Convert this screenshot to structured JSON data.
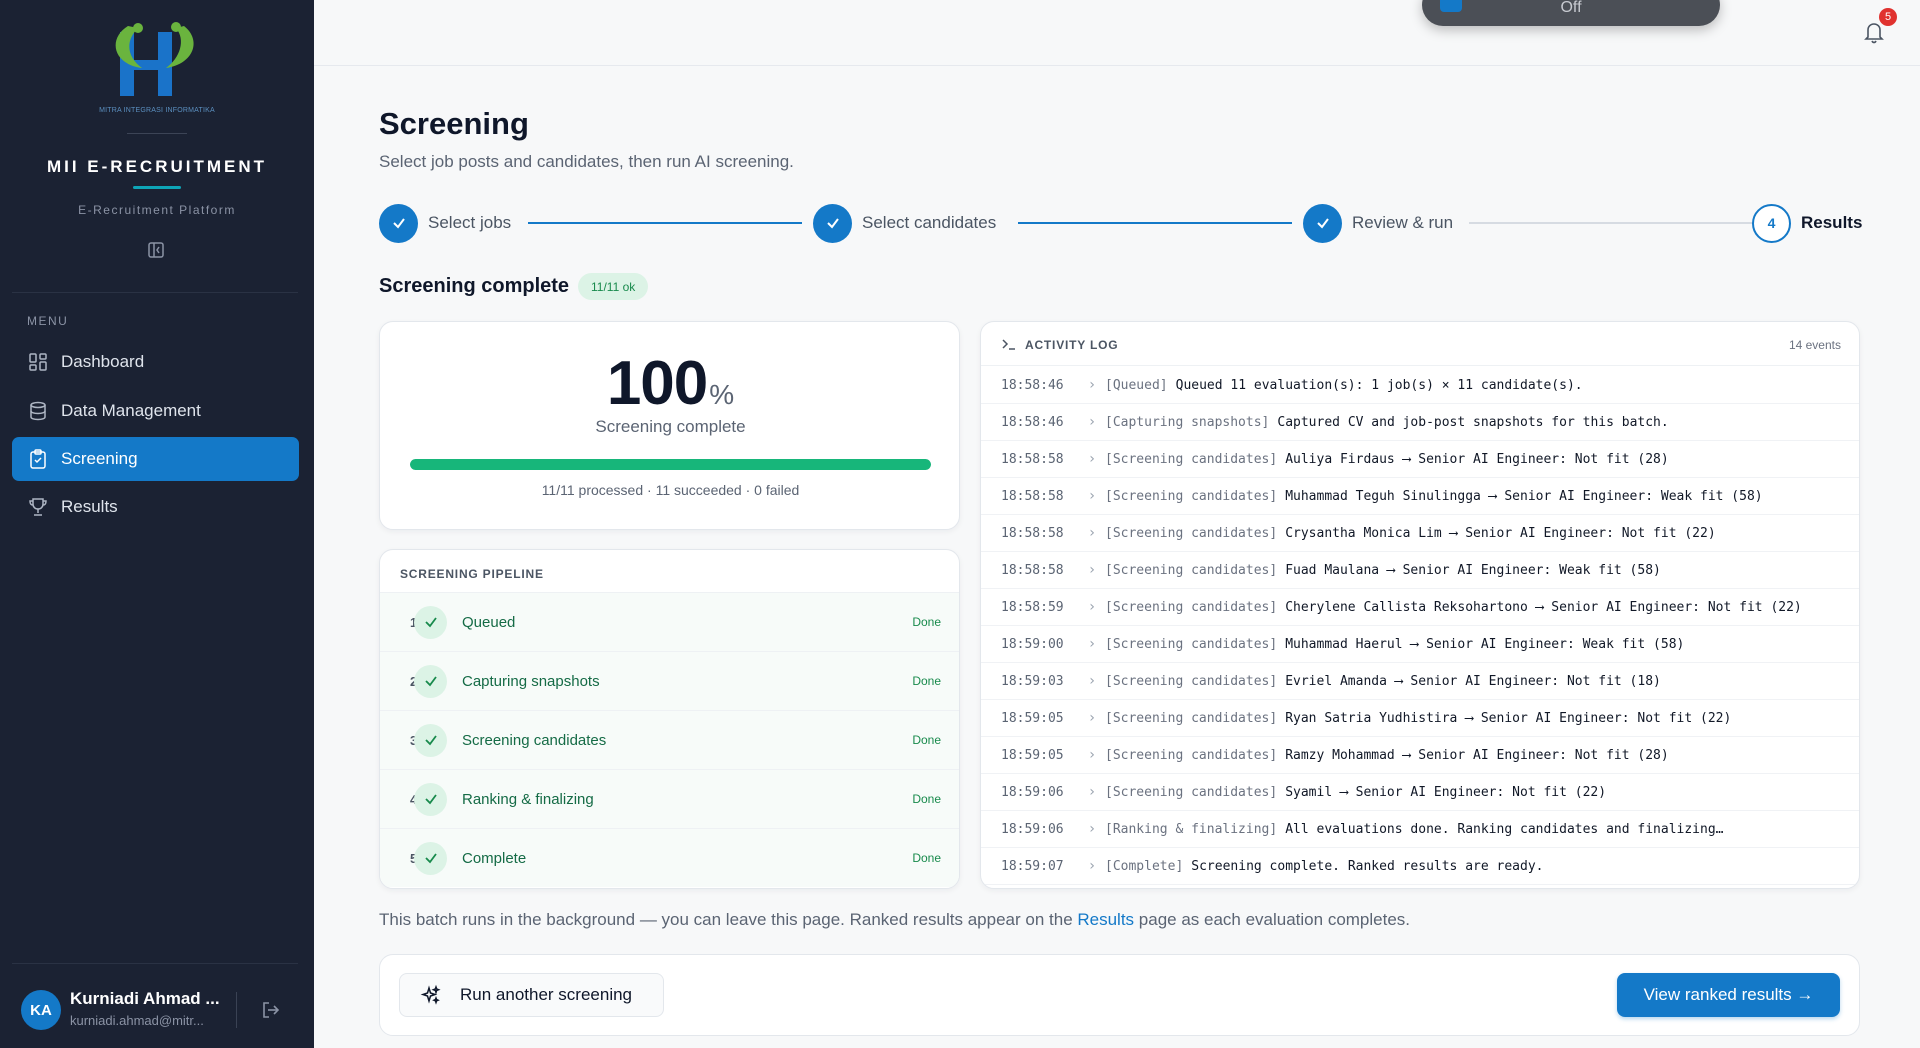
{
  "app": {
    "logo_subtitle": "MITRA INTEGRASI INFORMATIKA",
    "brand": "MII E-RECRUITMENT",
    "tagline": "E-Recruitment Platform"
  },
  "sidebar": {
    "menu_label": "MENU",
    "items": [
      {
        "label": "Dashboard",
        "icon": "dashboard-icon",
        "active": false
      },
      {
        "label": "Data Management",
        "icon": "database-icon",
        "active": false
      },
      {
        "label": "Screening",
        "icon": "clipboard-check-icon",
        "active": true
      },
      {
        "label": "Results",
        "icon": "trophy-icon",
        "active": false
      }
    ],
    "user": {
      "initials": "KA",
      "name": "Kurniadi Ahmad ...",
      "email": "kurniadi.ahmad@mitr..."
    }
  },
  "topbar": {
    "toggle_text": "Off",
    "notification_count": "5"
  },
  "page": {
    "title": "Screening",
    "subtitle": "Select job posts and candidates, then run AI screening."
  },
  "steps": [
    {
      "label": "Select jobs",
      "state": "done"
    },
    {
      "label": "Select candidates",
      "state": "done"
    },
    {
      "label": "Review & run",
      "state": "done"
    },
    {
      "label": "Results",
      "state": "current",
      "number": "4"
    }
  ],
  "status": {
    "title": "Screening complete",
    "badge": "11/11 ok"
  },
  "progress": {
    "percent_value": "100",
    "percent_unit": "%",
    "percent_fraction": 1.0,
    "label": "Screening complete",
    "stats": "11/11 processed · 11 succeeded · 0 failed",
    "bar_color": "#17b67a"
  },
  "pipeline": {
    "heading": "SCREENING PIPELINE",
    "stages": [
      {
        "num": "1",
        "name": "Queued",
        "status": "Done"
      },
      {
        "num": "2",
        "name": "Capturing snapshots",
        "status": "Done"
      },
      {
        "num": "3",
        "name": "Screening candidates",
        "status": "Done"
      },
      {
        "num": "4",
        "name": "Ranking & finalizing",
        "status": "Done"
      },
      {
        "num": "5",
        "name": "Complete",
        "status": "Done"
      }
    ]
  },
  "log": {
    "heading": "ACTIVITY LOG",
    "count": "14 events",
    "entries": [
      {
        "time": "18:58:46",
        "stage": "[Queued]",
        "message": "Queued 11 evaluation(s): 1 job(s) × 11 candidate(s)."
      },
      {
        "time": "18:58:46",
        "stage": "[Capturing snapshots]",
        "message": "Captured CV and job-post snapshots for this batch."
      },
      {
        "time": "18:58:58",
        "stage": "[Screening candidates]",
        "message": "Auliya Firdaus ⟶ Senior AI Engineer: Not fit (28)"
      },
      {
        "time": "18:58:58",
        "stage": "[Screening candidates]",
        "message": "Muhammad Teguh Sinulingga ⟶ Senior AI Engineer: Weak fit (58)"
      },
      {
        "time": "18:58:58",
        "stage": "[Screening candidates]",
        "message": "Crysantha Monica Lim ⟶ Senior AI Engineer: Not fit (22)"
      },
      {
        "time": "18:58:58",
        "stage": "[Screening candidates]",
        "message": "Fuad Maulana ⟶ Senior AI Engineer: Weak fit (58)"
      },
      {
        "time": "18:58:59",
        "stage": "[Screening candidates]",
        "message": "Cherylene Callista Reksohartono ⟶ Senior AI Engineer: Not fit (22)"
      },
      {
        "time": "18:59:00",
        "stage": "[Screening candidates]",
        "message": "Muhammad Haerul ⟶ Senior AI Engineer: Weak fit (58)"
      },
      {
        "time": "18:59:03",
        "stage": "[Screening candidates]",
        "message": "Evriel Amanda ⟶ Senior AI Engineer: Not fit (18)"
      },
      {
        "time": "18:59:05",
        "stage": "[Screening candidates]",
        "message": "Ryan Satria Yudhistira ⟶ Senior AI Engineer: Not fit (22)"
      },
      {
        "time": "18:59:05",
        "stage": "[Screening candidates]",
        "message": "Ramzy Mohammad ⟶ Senior AI Engineer: Not fit (28)"
      },
      {
        "time": "18:59:06",
        "stage": "[Screening candidates]",
        "message": "Syamil ⟶ Senior AI Engineer: Not fit (22)"
      },
      {
        "time": "18:59:06",
        "stage": "[Ranking & finalizing]",
        "message": "All evaluations done. Ranking candidates and finalizing…"
      },
      {
        "time": "18:59:07",
        "stage": "[Complete]",
        "message": "Screening complete. Ranked results are ready."
      }
    ]
  },
  "footer": {
    "note_before": "This batch runs in the background — you can leave this page. Ranked results appear on the ",
    "note_link": "Results",
    "note_after": " page as each evaluation completes.",
    "run_again_label": "Run another screening",
    "view_results_label": "View ranked results →"
  },
  "colors": {
    "accent": "#1479c8",
    "success": "#17b67a",
    "sidebar_bg": "#1b2233"
  }
}
